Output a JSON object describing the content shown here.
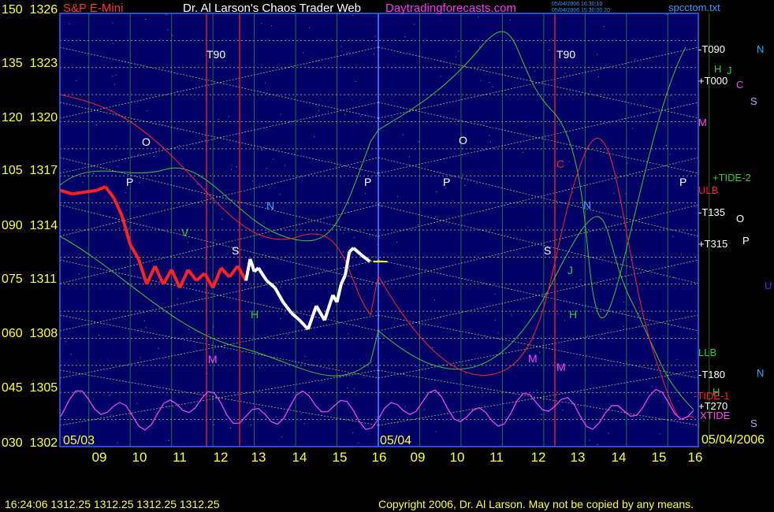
{
  "header": {
    "instrument": "S&P E-Mini",
    "title": "Dr. Al Larson's Chaos Trader Web",
    "site": "Daytradingforecasts.com",
    "file": "spcctom.txt",
    "stamp_line1": "05/04/2006 16:30:10",
    "stamp_line2": "05/04/2006 15:30:00 20"
  },
  "colors": {
    "background": "#000000",
    "plot_bg": "#000066",
    "axis_text": "#ffff33",
    "title_text": "#ffffff",
    "site_text": "#ff33ff",
    "file_text": "#3399ff",
    "price_bar": "#ff2020",
    "price_bar_recent": "#ffffff",
    "grid_dotted": "#ffff66",
    "green_line": "#33cc33",
    "red_line": "#ff2020",
    "magenta_line": "#ff44ff"
  },
  "footer": {
    "quote": "16:24:06  1312.25  1312.25  1312.25  1312.25",
    "copyright": "Copyright 2006, Dr. Al Larson. May not be copied by any means."
  },
  "chart_data": {
    "type": "line",
    "title": "S&P E-Mini",
    "y_axis_left": [
      {
        "deg": "150",
        "price": "1326"
      },
      {
        "deg": "135",
        "price": "1323"
      },
      {
        "deg": "120",
        "price": "1320"
      },
      {
        "deg": "105",
        "price": "1317"
      },
      {
        "deg": "090",
        "price": "1314"
      },
      {
        "deg": "075",
        "price": "1311"
      },
      {
        "deg": "060",
        "price": "1308"
      },
      {
        "deg": "045",
        "price": "1305"
      },
      {
        "deg": "030",
        "price": "1302"
      }
    ],
    "ylim": [
      1302,
      1326
    ],
    "x_ticks": [
      "09",
      "10",
      "11",
      "12",
      "13",
      "14",
      "15",
      "16",
      "09",
      "10",
      "11",
      "12",
      "13",
      "14",
      "15",
      "16"
    ],
    "date_labels": [
      "05/03",
      "05/04",
      "05/04/2006"
    ],
    "right_labels": [
      {
        "text": "-T090",
        "color": "#ffffff"
      },
      {
        "text": "H",
        "color": "#33cc33"
      },
      {
        "text": "J",
        "color": "#33cc33"
      },
      {
        "text": "+T000",
        "color": "#ffffff"
      },
      {
        "text": "C",
        "color": "#ff44ff"
      },
      {
        "text": "S",
        "color": "#aaaaff"
      },
      {
        "text": "N",
        "color": "#33aaff"
      },
      {
        "text": "M",
        "color": "#ff44ff"
      },
      {
        "text": "+TIDE-2",
        "color": "#33cc33"
      },
      {
        "text": "ULB",
        "color": "#ff2020"
      },
      {
        "text": "-T135",
        "color": "#ffffff"
      },
      {
        "text": "O",
        "color": "#ffffff"
      },
      {
        "text": "+T315",
        "color": "#ffffff"
      },
      {
        "text": "P",
        "color": "#ffffff"
      },
      {
        "text": "U",
        "color": "#3333ff"
      },
      {
        "text": "LLB",
        "color": "#33cc33"
      },
      {
        "text": "-T180",
        "color": "#ffffff"
      },
      {
        "text": "N",
        "color": "#33aaff"
      },
      {
        "text": "H",
        "color": "#33cc33"
      },
      {
        "text": "-TIDE-1",
        "color": "#ff2020"
      },
      {
        "text": "+T270",
        "color": "#ffffff"
      },
      {
        "text": "XTIDE",
        "color": "#ff44ff"
      },
      {
        "text": "S",
        "color": "#aaaaff"
      }
    ],
    "in_chart_labels": [
      {
        "text": "T90",
        "color": "#ffffff"
      },
      {
        "text": "T90",
        "color": "#ffffff"
      },
      {
        "text": "O",
        "color": "#ffffff"
      },
      {
        "text": "P",
        "color": "#ffffff"
      },
      {
        "text": "N",
        "color": "#33aaff"
      },
      {
        "text": "H",
        "color": "#33cc33"
      },
      {
        "text": "M",
        "color": "#ff44ff"
      },
      {
        "text": "P",
        "color": "#ffffff"
      },
      {
        "text": "P",
        "color": "#ffffff"
      },
      {
        "text": "O",
        "color": "#ffffff"
      },
      {
        "text": "C",
        "color": "#ff2020"
      },
      {
        "text": "N",
        "color": "#33aaff"
      },
      {
        "text": "S",
        "color": "#ffffff"
      },
      {
        "text": "J",
        "color": "#33cc33"
      },
      {
        "text": "H",
        "color": "#33cc33"
      },
      {
        "text": "M",
        "color": "#ff44ff"
      },
      {
        "text": "M",
        "color": "#ff44ff"
      },
      {
        "text": "P",
        "color": "#ffffff"
      },
      {
        "text": "S",
        "color": "#ffffff"
      },
      {
        "text": "V",
        "color": "#33cc33"
      }
    ],
    "price_series": {
      "name": "S&P E-Mini",
      "x": [
        8.3,
        8.6,
        8.9,
        9.2,
        9.4,
        9.6,
        9.8,
        10.0,
        10.2,
        10.4,
        10.6,
        10.8,
        11.0,
        11.2,
        11.4,
        11.6,
        11.8,
        12.0,
        12.2,
        12.4,
        12.6,
        12.8,
        12.9,
        13.0,
        13.1,
        13.3,
        13.5,
        13.7,
        13.9,
        14.1,
        14.3,
        14.5,
        14.7,
        14.9,
        15.0,
        15.1,
        15.2,
        15.3,
        15.4,
        15.6,
        15.8
      ],
      "y": [
        1316.2,
        1316.0,
        1316.1,
        1316.2,
        1316.4,
        1315.8,
        1314.8,
        1313.2,
        1312.4,
        1311.0,
        1312.0,
        1311.0,
        1311.8,
        1310.8,
        1311.8,
        1311.2,
        1311.6,
        1310.8,
        1311.9,
        1311.4,
        1312.0,
        1311.2,
        1312.4,
        1311.7,
        1311.9,
        1311.2,
        1310.8,
        1310.0,
        1309.4,
        1309.0,
        1308.5,
        1309.8,
        1309.0,
        1310.4,
        1310.0,
        1311.0,
        1311.5,
        1312.8,
        1313.0,
        1312.6,
        1312.25
      ],
      "recent_from_index": 21
    },
    "last_price": 1312.25,
    "grid": true,
    "legend": "right"
  }
}
